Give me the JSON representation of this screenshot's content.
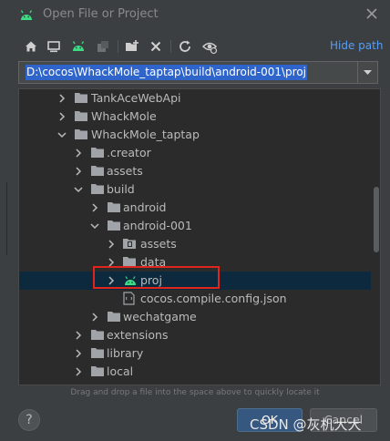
{
  "window": {
    "title": "Open File or Project",
    "close_icon": "close-icon"
  },
  "toolbar": {
    "icons": [
      "home-icon",
      "desktop-icon",
      "android-project-icon",
      "module-icon",
      "new-folder-icon",
      "delete-icon",
      "refresh-icon",
      "show-hidden-icon"
    ],
    "hide_path_label": "Hide path"
  },
  "path_combo": {
    "value": "D:\\cocos\\WhackMole_taptap\\build\\android-001\\proj"
  },
  "tree": {
    "rows": [
      {
        "label": "TankAceWebApi",
        "expanded": false,
        "icon": "folder-icon"
      },
      {
        "label": "WhackMole",
        "expanded": false,
        "icon": "folder-icon"
      },
      {
        "label": "WhackMole_taptap",
        "expanded": true,
        "icon": "folder-icon"
      },
      {
        "label": ".creator",
        "expanded": false,
        "icon": "folder-icon"
      },
      {
        "label": "assets",
        "expanded": false,
        "icon": "folder-icon"
      },
      {
        "label": "build",
        "expanded": true,
        "icon": "folder-icon"
      },
      {
        "label": "android",
        "expanded": false,
        "icon": "folder-icon"
      },
      {
        "label": "android-001",
        "expanded": true,
        "icon": "folder-icon"
      },
      {
        "label": "assets",
        "expanded": false,
        "icon": "folder-icon"
      },
      {
        "label": "data",
        "expanded": false,
        "icon": "folder-icon"
      },
      {
        "label": "proj",
        "expanded": false,
        "icon": "android-icon"
      },
      {
        "label": "cocos.compile.config.json",
        "expanded": null,
        "icon": "json-file-icon"
      },
      {
        "label": "wechatgame",
        "expanded": false,
        "icon": "folder-icon"
      },
      {
        "label": "extensions",
        "expanded": false,
        "icon": "folder-icon"
      },
      {
        "label": "library",
        "expanded": false,
        "icon": "folder-icon"
      },
      {
        "label": "local",
        "expanded": false,
        "icon": "folder-icon"
      }
    ],
    "selected": "proj"
  },
  "hint": "Drag and drop a file into the space above to quickly locate it",
  "buttons": {
    "help_label": "?",
    "ok_label": "OK",
    "cancel_label": "Cancel"
  },
  "watermark": "CSDN @灰机大大",
  "colors": {
    "background": "#3c3f41",
    "tree_background": "#2b2b2b",
    "selection": "#0d293e",
    "highlight_box": "#e0261c",
    "link": "#589df6",
    "android_green": "#3ddc84",
    "folder": "#a0a4a8"
  }
}
